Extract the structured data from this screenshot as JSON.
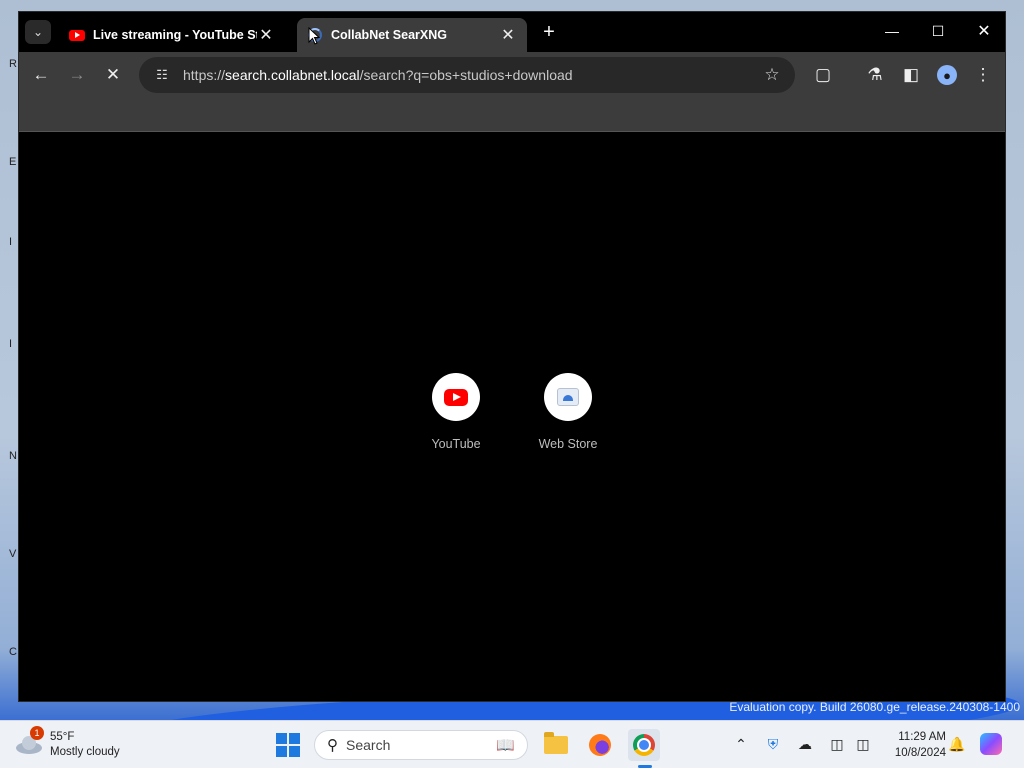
{
  "desktop": {
    "watermark": "Evaluation copy. Build 26080.ge_release.240308-1400",
    "letters": [
      "R",
      "E",
      "I",
      "I",
      "N",
      "V",
      "C"
    ]
  },
  "browser": {
    "tabs": [
      {
        "title": "Live streaming - YouTube Studio",
        "favicon": "youtube-icon",
        "active": false
      },
      {
        "title": "CollabNet SearXNG",
        "favicon": "loading-spinner-icon",
        "active": true
      }
    ],
    "url_scheme": "https://",
    "url_host": "search.collabnet.local",
    "url_path": "/search?q=obs+studios+download",
    "shortcuts": [
      {
        "label": "YouTube",
        "icon": "youtube-icon"
      },
      {
        "label": "Web Store",
        "icon": "web-store-icon"
      }
    ]
  },
  "taskbar": {
    "weather_temp": "55°F",
    "weather_desc": "Mostly cloudy",
    "weather_badge": "1",
    "search_placeholder": "Search",
    "time": "11:29 AM",
    "date": "10/8/2024"
  },
  "colors": {
    "accent": "#1f7ae0",
    "toolbar": "#3c3c3c",
    "youtube_red": "#ff0000"
  }
}
